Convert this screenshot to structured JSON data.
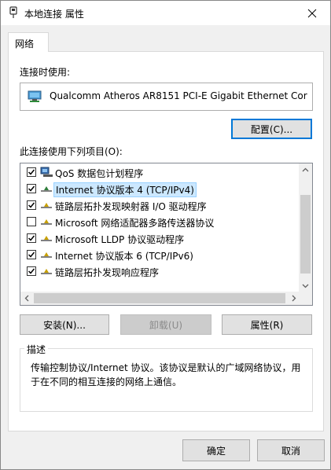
{
  "window": {
    "title": "本地连接 属性"
  },
  "tabs": [
    {
      "label": "网络"
    }
  ],
  "connect_using": {
    "label": "连接时使用:",
    "adapter_name": "Qualcomm Atheros AR8151 PCI-E Gigabit Ethernet Cor",
    "configure_button": "配置(C)..."
  },
  "items_section": {
    "label": "此连接使用下列项目(O):"
  },
  "items": [
    {
      "label": "QoS 数据包计划程序",
      "checked": true,
      "icon": "qos-icon"
    },
    {
      "label": "Internet 协议版本 4 (TCP/IPv4)",
      "checked": true,
      "icon": "protocol-icon",
      "selected": true
    },
    {
      "label": "链路层拓扑发现映射器 I/O 驱动程序",
      "checked": true,
      "icon": "protocol-icon"
    },
    {
      "label": "Microsoft 网络适配器多路传送器协议",
      "checked": false,
      "icon": "protocol-icon"
    },
    {
      "label": "Microsoft LLDP 协议驱动程序",
      "checked": true,
      "icon": "protocol-icon"
    },
    {
      "label": "Internet 协议版本 6 (TCP/IPv6)",
      "checked": true,
      "icon": "protocol-icon"
    },
    {
      "label": "链路层拓扑发现响应程序",
      "checked": true,
      "icon": "protocol-icon"
    }
  ],
  "item_buttons": {
    "install": "安装(N)...",
    "uninstall": "卸载(U)",
    "properties": "属性(R)"
  },
  "description": {
    "title": "描述",
    "text": "传输控制协议/Internet 协议。该协议是默认的广域网络协议，用于在不同的相互连接的网络上通信。"
  },
  "footer": {
    "ok": "确定",
    "cancel": "取消"
  }
}
